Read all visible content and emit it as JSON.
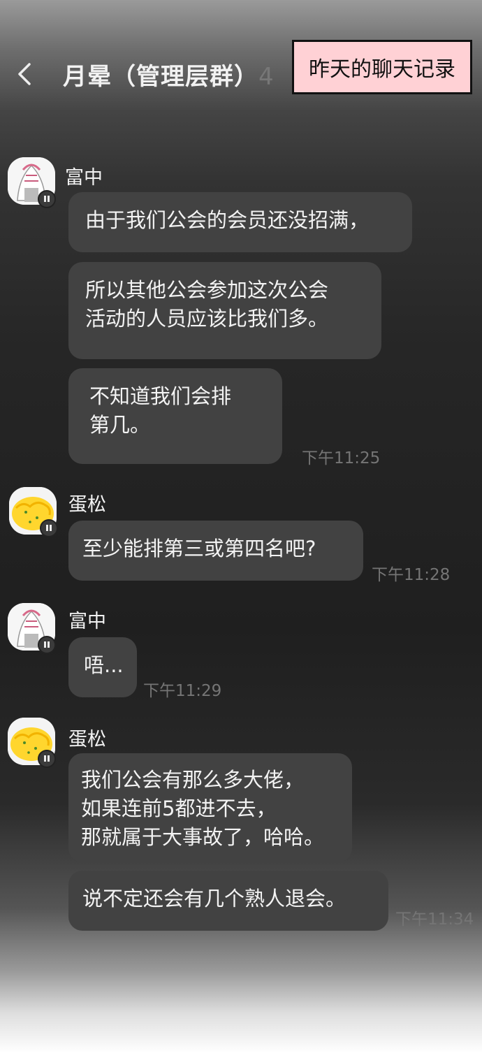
{
  "header": {
    "title": "月晕（管理层群）",
    "member_count": "4",
    "caption": "昨天的聊天记录"
  },
  "messages": [
    {
      "sender": "富中",
      "lines": [
        "由于我们公会的会员还没招满，",
        "所以其他公会参加这次公会\n活动的人员应该比我们多。",
        "不知道我们会排\n第几。"
      ],
      "time": "下午11:25"
    },
    {
      "sender": "蛋松",
      "lines": [
        "至少能排第三或第四名吧?"
      ],
      "time": "下午11:28"
    },
    {
      "sender": "富中",
      "lines": [
        "唔..."
      ],
      "time": "下午11:29"
    },
    {
      "sender": "蛋松",
      "lines": [
        "我们公会有那么多大佬，\n如果连前5都进不去，\n那就属于大事故了，哈哈。",
        "说不定还会有几个熟人退会。"
      ],
      "time": "下午11:34"
    }
  ]
}
